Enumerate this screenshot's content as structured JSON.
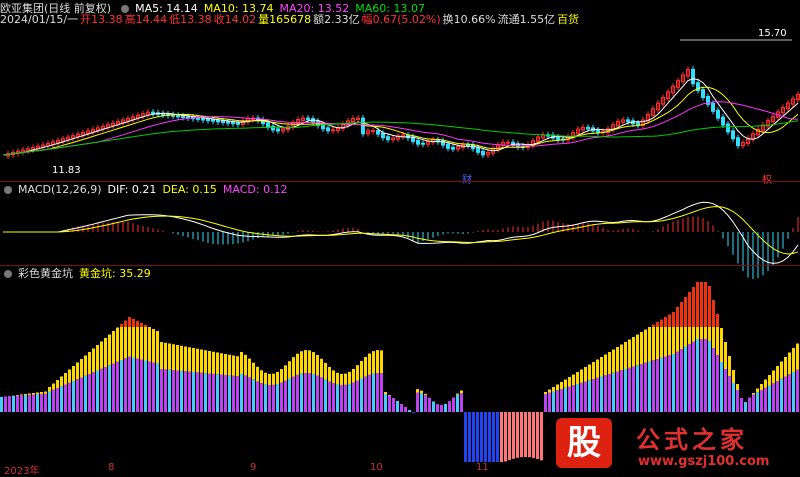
{
  "header": {
    "stock_name": "欧亚集团(日线 前复权)",
    "ma5": "MA5: 14.14",
    "ma10": "MA10: 13.74",
    "ma20": "MA20: 13.52",
    "ma60": "MA60: 13.07",
    "date": "2024/01/15/一",
    "open": "开13.38",
    "high": "高14.44",
    "low": "低13.38",
    "close": "收14.02",
    "volume": "量165678",
    "amount": "额2.33亿",
    "change": "幅0.67(5.02%)",
    "turnover": "换10.66%",
    "float_cap": "流通1.55亿",
    "sector": "百货"
  },
  "price_labels": {
    "high_marker": "15.70",
    "low_marker": "11.83"
  },
  "markers": {
    "cai": "财",
    "quan": "权"
  },
  "macd": {
    "title": "MACD(12,26,9)",
    "dif": "DIF: 0.21",
    "dea": "DEA: 0.15",
    "macd": "MACD: 0.12"
  },
  "indicator": {
    "title": "彩色黄金坑",
    "value_label": "黄金坑: 35.29"
  },
  "x_axis": [
    "2023年",
    "8",
    "9",
    "10",
    "11"
  ],
  "watermark": {
    "logo_char": "股",
    "title": "公式之家",
    "url": "www.gszj100.com"
  },
  "colors": {
    "up": "#ff3030",
    "down": "#33ddff",
    "ma5": "#ffffff",
    "ma10": "#ffff00",
    "ma20": "#ff33ff",
    "ma60": "#00cc00",
    "yellow": "#ffd700",
    "magenta": "#bb44ee",
    "cyan": "#44ccff",
    "red": "#ee3311",
    "blue": "#2244ee",
    "salmon": "#ff7777"
  }
}
